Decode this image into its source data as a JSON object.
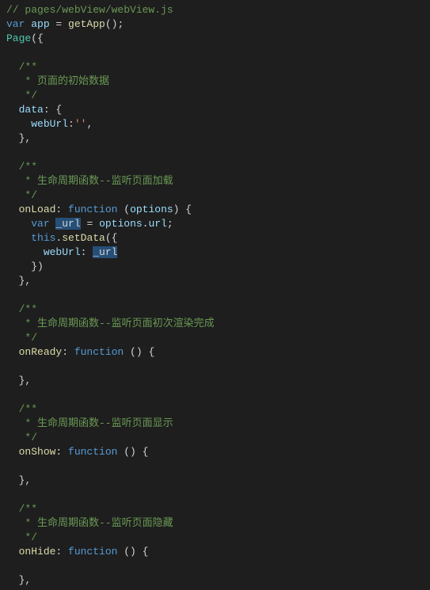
{
  "lines": [
    [
      {
        "c": "comment",
        "t": "// pages/webView/webView.js"
      }
    ],
    [
      {
        "c": "keyword",
        "t": "var"
      },
      {
        "c": "",
        "t": " "
      },
      {
        "c": "variable",
        "t": "app"
      },
      {
        "c": "",
        "t": " = "
      },
      {
        "c": "func-call",
        "t": "getApp"
      },
      {
        "c": "paren",
        "t": "();"
      }
    ],
    [
      {
        "c": "type",
        "t": "Page"
      },
      {
        "c": "paren",
        "t": "({"
      }
    ],
    [],
    [
      {
        "c": "",
        "t": "  "
      },
      {
        "c": "comment",
        "t": "/**"
      }
    ],
    [
      {
        "c": "",
        "t": "   "
      },
      {
        "c": "comment",
        "t": "* 页面的初始数据"
      }
    ],
    [
      {
        "c": "",
        "t": "   "
      },
      {
        "c": "comment",
        "t": "*/"
      }
    ],
    [
      {
        "c": "",
        "t": "  "
      },
      {
        "c": "variable",
        "t": "data"
      },
      {
        "c": "",
        "t": ": {"
      }
    ],
    [
      {
        "c": "",
        "t": "    "
      },
      {
        "c": "variable",
        "t": "webUrl"
      },
      {
        "c": "",
        "t": ":"
      },
      {
        "c": "string",
        "t": "''"
      },
      {
        "c": "",
        "t": ","
      }
    ],
    [
      {
        "c": "",
        "t": "  },"
      }
    ],
    [],
    [
      {
        "c": "",
        "t": "  "
      },
      {
        "c": "comment",
        "t": "/**"
      }
    ],
    [
      {
        "c": "",
        "t": "   "
      },
      {
        "c": "comment",
        "t": "* 生命周期函数--监听页面加载"
      }
    ],
    [
      {
        "c": "",
        "t": "   "
      },
      {
        "c": "comment",
        "t": "*/"
      }
    ],
    [
      {
        "c": "",
        "t": "  "
      },
      {
        "c": "func-call",
        "t": "onLoad"
      },
      {
        "c": "",
        "t": ": "
      },
      {
        "c": "keyword",
        "t": "function"
      },
      {
        "c": "",
        "t": " ("
      },
      {
        "c": "variable",
        "t": "options"
      },
      {
        "c": "",
        "t": ") {"
      }
    ],
    [
      {
        "c": "",
        "t": "    "
      },
      {
        "c": "keyword",
        "t": "var"
      },
      {
        "c": "",
        "t": " "
      },
      {
        "c": "selected",
        "t": "_url"
      },
      {
        "c": "",
        "t": " = "
      },
      {
        "c": "variable",
        "t": "options"
      },
      {
        "c": "",
        "t": "."
      },
      {
        "c": "variable",
        "t": "url"
      },
      {
        "c": "",
        "t": ";"
      }
    ],
    [
      {
        "c": "",
        "t": "    "
      },
      {
        "c": "keyword",
        "t": "this"
      },
      {
        "c": "",
        "t": "."
      },
      {
        "c": "func-call",
        "t": "setData"
      },
      {
        "c": "",
        "t": "({"
      }
    ],
    [
      {
        "c": "",
        "t": "      "
      },
      {
        "c": "variable",
        "t": "webUrl"
      },
      {
        "c": "",
        "t": ": "
      },
      {
        "c": "selected",
        "t": "_url"
      }
    ],
    [
      {
        "c": "",
        "t": "    })"
      }
    ],
    [
      {
        "c": "",
        "t": "  },"
      }
    ],
    [],
    [
      {
        "c": "",
        "t": "  "
      },
      {
        "c": "comment",
        "t": "/**"
      }
    ],
    [
      {
        "c": "",
        "t": "   "
      },
      {
        "c": "comment",
        "t": "* 生命周期函数--监听页面初次渲染完成"
      }
    ],
    [
      {
        "c": "",
        "t": "   "
      },
      {
        "c": "comment",
        "t": "*/"
      }
    ],
    [
      {
        "c": "",
        "t": "  "
      },
      {
        "c": "func-call",
        "t": "onReady"
      },
      {
        "c": "",
        "t": ": "
      },
      {
        "c": "keyword",
        "t": "function"
      },
      {
        "c": "",
        "t": " () {"
      }
    ],
    [],
    [
      {
        "c": "",
        "t": "  },"
      }
    ],
    [],
    [
      {
        "c": "",
        "t": "  "
      },
      {
        "c": "comment",
        "t": "/**"
      }
    ],
    [
      {
        "c": "",
        "t": "   "
      },
      {
        "c": "comment",
        "t": "* 生命周期函数--监听页面显示"
      }
    ],
    [
      {
        "c": "",
        "t": "   "
      },
      {
        "c": "comment",
        "t": "*/"
      }
    ],
    [
      {
        "c": "",
        "t": "  "
      },
      {
        "c": "func-call",
        "t": "onShow"
      },
      {
        "c": "",
        "t": ": "
      },
      {
        "c": "keyword",
        "t": "function"
      },
      {
        "c": "",
        "t": " () {"
      }
    ],
    [],
    [
      {
        "c": "",
        "t": "  },"
      }
    ],
    [],
    [
      {
        "c": "",
        "t": "  "
      },
      {
        "c": "comment",
        "t": "/**"
      }
    ],
    [
      {
        "c": "",
        "t": "   "
      },
      {
        "c": "comment",
        "t": "* 生命周期函数--监听页面隐藏"
      }
    ],
    [
      {
        "c": "",
        "t": "   "
      },
      {
        "c": "comment",
        "t": "*/"
      }
    ],
    [
      {
        "c": "",
        "t": "  "
      },
      {
        "c": "func-call",
        "t": "onHide"
      },
      {
        "c": "",
        "t": ": "
      },
      {
        "c": "keyword",
        "t": "function"
      },
      {
        "c": "",
        "t": " () {"
      }
    ],
    [],
    [
      {
        "c": "",
        "t": "  },"
      }
    ]
  ]
}
